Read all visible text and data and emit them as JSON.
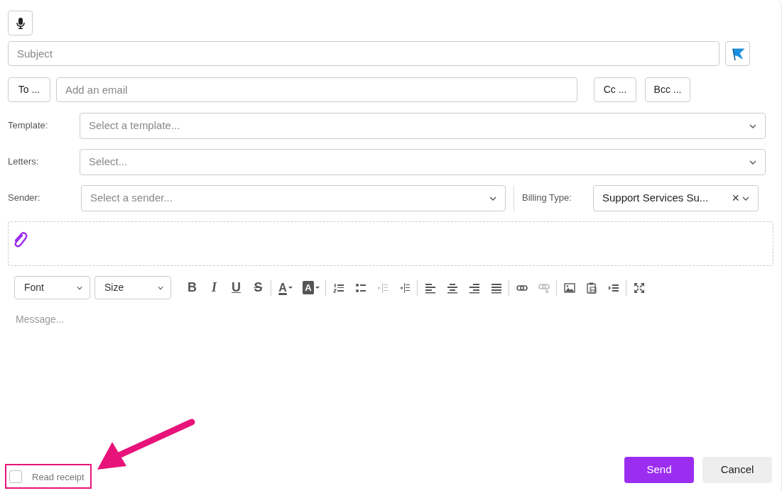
{
  "subject": {
    "placeholder": "Subject",
    "flagged": true
  },
  "recipients": {
    "to_button": "To ...",
    "placeholder": "Add an email",
    "cc_button": "Cc ...",
    "bcc_button": "Bcc ..."
  },
  "fields": [
    {
      "label": "Template:",
      "placeholder": "Select a template..."
    },
    {
      "label": "Letters:",
      "placeholder": "Select..."
    }
  ],
  "sender": {
    "label": "Sender:",
    "placeholder": "Select a sender..."
  },
  "billing": {
    "label": "Billing Type:",
    "value": "Support Services Su...",
    "clear": "×"
  },
  "toolbar": {
    "dropdowns": [
      "Font",
      "Size"
    ],
    "groups": [
      [
        {
          "kind": "bold",
          "label": "B",
          "disabled": false
        },
        {
          "kind": "italic",
          "label": "I",
          "disabled": false
        },
        {
          "kind": "underline",
          "label": "U",
          "disabled": false
        },
        {
          "kind": "strike",
          "label": "S",
          "disabled": false
        }
      ],
      [
        {
          "kind": "text-color",
          "label": "A",
          "disabled": false
        },
        {
          "kind": "back-color",
          "label": "A",
          "disabled": false
        }
      ],
      [
        {
          "kind": "ordered-list",
          "disabled": false
        },
        {
          "kind": "bullet-list",
          "disabled": false
        },
        {
          "kind": "outdent",
          "disabled": true
        },
        {
          "kind": "indent",
          "disabled": false
        }
      ],
      [
        {
          "kind": "align-left",
          "disabled": false
        },
        {
          "kind": "align-center",
          "disabled": false
        },
        {
          "kind": "align-right",
          "disabled": false
        },
        {
          "kind": "justify",
          "disabled": false
        }
      ],
      [
        {
          "kind": "link",
          "disabled": false
        },
        {
          "kind": "unlink",
          "disabled": true
        }
      ],
      [
        {
          "kind": "image",
          "disabled": false
        },
        {
          "kind": "paste-word",
          "disabled": false
        },
        {
          "kind": "insert-line",
          "disabled": false
        }
      ],
      [
        {
          "kind": "fullscreen",
          "disabled": false
        }
      ]
    ]
  },
  "message": {
    "placeholder": "Message..."
  },
  "read_receipt": {
    "label": "Read receipt",
    "checked": false,
    "highlighted": true
  },
  "buttons": [
    {
      "kind": "primary",
      "label": "Send"
    },
    {
      "kind": "secondary",
      "label": "Cancel"
    }
  ],
  "annotation_arrow": true
}
